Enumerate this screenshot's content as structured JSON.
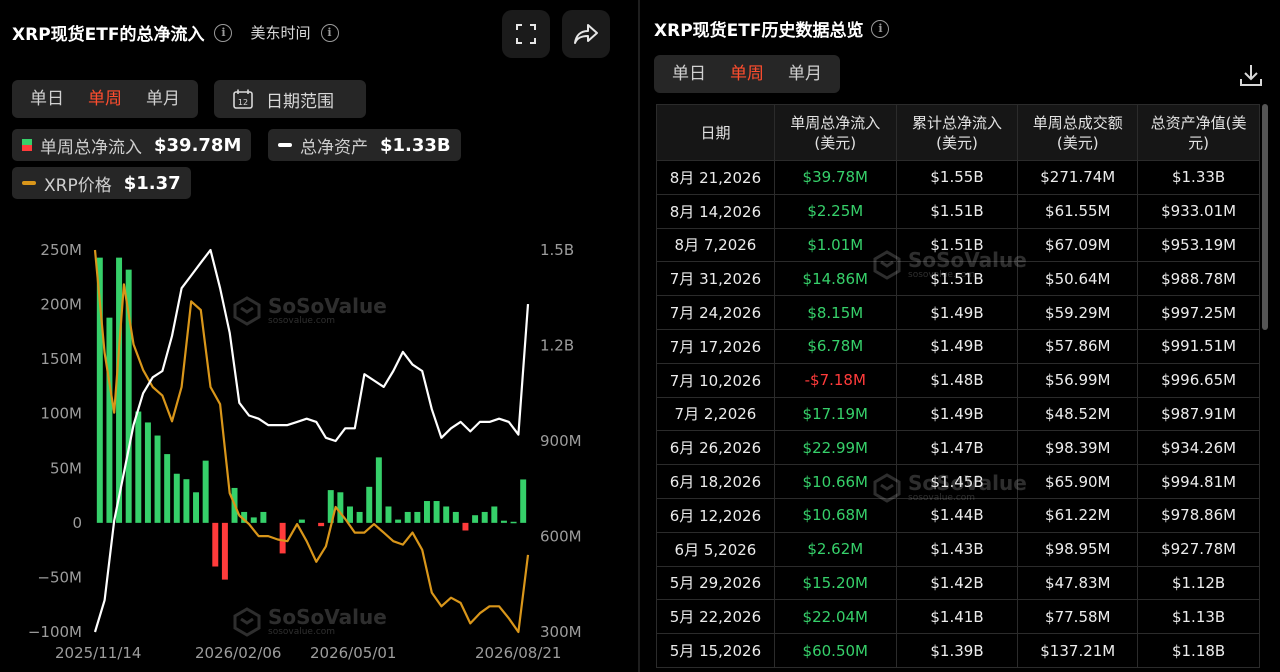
{
  "left": {
    "title": "XRP现货ETF的总净流入",
    "timezone": "美东时间",
    "tabs": [
      {
        "label": "单日",
        "active": false
      },
      {
        "label": "单周",
        "active": true
      },
      {
        "label": "单月",
        "active": false
      }
    ],
    "date_range_label": "日期范围",
    "date_range_icon_text": "12",
    "legend": [
      {
        "label": "单周总净流入",
        "value": "$39.78M",
        "swatch": "bar"
      },
      {
        "label": "总净资产",
        "value": "$1.33B",
        "swatch": "white-line"
      },
      {
        "label": "XRP价格",
        "value": "$1.37",
        "swatch": "gold-line"
      }
    ]
  },
  "right": {
    "title": "XRP现货ETF历史数据总览",
    "tabs": [
      {
        "label": "单日",
        "active": false
      },
      {
        "label": "单周",
        "active": true
      },
      {
        "label": "单月",
        "active": false
      }
    ],
    "columns": [
      "日期",
      "单周总净流入\n(美元)",
      "累计总净流入\n(美元)",
      "单周总成交额\n(美元)",
      "总资产净值(美\n元)"
    ],
    "rows": [
      [
        "8月 21,2026",
        "$39.78M",
        "$1.55B",
        "$271.74M",
        "$1.33B"
      ],
      [
        "8月 14,2026",
        "$2.25M",
        "$1.51B",
        "$61.55M",
        "$933.01M"
      ],
      [
        "8月 7,2026",
        "$1.01M",
        "$1.51B",
        "$67.09M",
        "$953.19M"
      ],
      [
        "7月 31,2026",
        "$14.86M",
        "$1.51B",
        "$50.64M",
        "$988.78M"
      ],
      [
        "7月 24,2026",
        "$8.15M",
        "$1.49B",
        "$59.29M",
        "$997.25M"
      ],
      [
        "7月 17,2026",
        "$6.78M",
        "$1.49B",
        "$57.86M",
        "$991.51M"
      ],
      [
        "7月 10,2026",
        "-$7.18M",
        "$1.48B",
        "$56.99M",
        "$996.65M"
      ],
      [
        "7月 2,2026",
        "$17.19M",
        "$1.49B",
        "$48.52M",
        "$987.91M"
      ],
      [
        "6月 26,2026",
        "$22.99M",
        "$1.47B",
        "$98.39M",
        "$934.26M"
      ],
      [
        "6月 18,2026",
        "$10.66M",
        "$1.45B",
        "$65.90M",
        "$994.81M"
      ],
      [
        "6月 12,2026",
        "$10.68M",
        "$1.44B",
        "$61.22M",
        "$978.86M"
      ],
      [
        "6月 5,2026",
        "$2.62M",
        "$1.43B",
        "$98.95M",
        "$927.78M"
      ],
      [
        "5月 29,2026",
        "$15.20M",
        "$1.42B",
        "$47.83M",
        "$1.12B"
      ],
      [
        "5月 22,2026",
        "$22.04M",
        "$1.41B",
        "$77.58M",
        "$1.13B"
      ],
      [
        "5月 15,2026",
        "$60.50M",
        "$1.39B",
        "$137.21M",
        "$1.18B"
      ]
    ]
  },
  "watermark": {
    "name": "SoSoValue",
    "url": "sosovalue.com"
  },
  "colors": {
    "positive": "#36d06a",
    "negative": "#ff3b3b",
    "asset_line": "#ffffff",
    "price_line": "#d9961a",
    "accent": "#ff4d2e"
  },
  "chart_data": {
    "type": "bar",
    "x_ticks": [
      "2025/11/14",
      "2026/02/06",
      "2026/05/01",
      "2026/08/21"
    ],
    "y_left_ticks": [
      "250M",
      "200M",
      "150M",
      "100M",
      "50M",
      "0",
      "−50M",
      "−100M"
    ],
    "y_left_range": [
      -100,
      250
    ],
    "y_right_ticks": [
      "1.5B",
      "1.2B",
      "900M",
      "600M",
      "300M"
    ],
    "y_right_range": [
      300,
      1500
    ],
    "series": [
      {
        "name": "单周总净流入",
        "type": "bar",
        "values": [
          243,
          188,
          243,
          232,
          102,
          92,
          80,
          63,
          45,
          40,
          28,
          57,
          -40,
          -52,
          32,
          10,
          5,
          10,
          0,
          -28,
          0,
          3,
          0,
          -3,
          30,
          28,
          15,
          10,
          33,
          60,
          15,
          3,
          10,
          10,
          20,
          20,
          15,
          10,
          -7,
          7,
          10,
          15,
          2,
          1,
          39.78
        ]
      },
      {
        "name": "总净资产",
        "type": "line",
        "unit": "M",
        "values": [
          300,
          400,
          650,
          800,
          950,
          1050,
          1100,
          1120,
          1230,
          1380,
          1420,
          1460,
          1500,
          1380,
          1240,
          1020,
          980,
          970,
          950,
          950,
          950,
          960,
          970,
          960,
          910,
          900,
          940,
          940,
          1110,
          1090,
          1070,
          1120,
          1180,
          1140,
          1120,
          1000,
          910,
          940,
          960,
          930,
          960,
          960,
          970,
          960,
          920,
          1330
        ]
      },
      {
        "name": "XRP价格",
        "type": "line",
        "unit": "USD",
        "values": [
          3.15,
          2.55,
          2.2,
          2.95,
          2.6,
          2.45,
          2.35,
          2.3,
          2.15,
          2.35,
          2.85,
          2.8,
          2.35,
          2.25,
          1.73,
          1.6,
          1.55,
          1.48,
          1.48,
          1.46,
          1.45,
          1.55,
          1.45,
          1.33,
          1.42,
          1.65,
          1.58,
          1.5,
          1.5,
          1.55,
          1.5,
          1.45,
          1.43,
          1.5,
          1.4,
          1.15,
          1.07,
          1.12,
          1.09,
          0.97,
          1.03,
          1.07,
          1.07,
          1.0,
          0.92,
          1.37
        ]
      }
    ]
  }
}
